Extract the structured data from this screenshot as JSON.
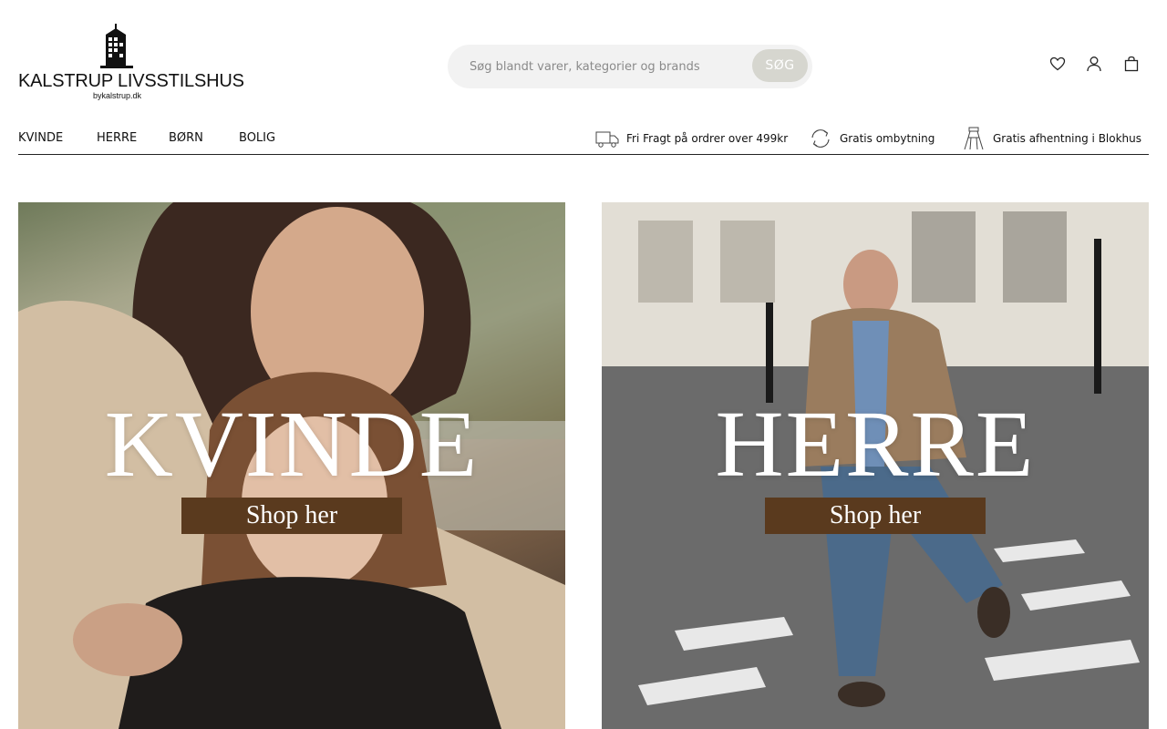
{
  "brand": {
    "name": "KALSTRUP LIVSSTILSHUS",
    "tagline": "bykalstrup.dk"
  },
  "search": {
    "placeholder": "Søg blandt varer, kategorier og brands",
    "button_label": "SØG"
  },
  "header_icons": [
    "heart-icon",
    "user-icon",
    "bag-icon"
  ],
  "nav": {
    "items": [
      {
        "label": "KVINDE"
      },
      {
        "label": "HERRE"
      },
      {
        "label": "BØRN"
      },
      {
        "label": "BOLIG"
      }
    ]
  },
  "usps": [
    {
      "icon": "truck-icon",
      "text": "Fri Fragt på ordrer over 499kr"
    },
    {
      "icon": "exchange-icon",
      "text": "Gratis ombytning"
    },
    {
      "icon": "pickup-icon",
      "text": "Gratis afhentning i Blokhus"
    }
  ],
  "tiles": [
    {
      "title": "KVINDE",
      "cta": "Shop her"
    },
    {
      "title": "HERRE",
      "cta": "Shop her"
    }
  ],
  "colors": {
    "cta_background": "#5a3a1e",
    "search_background": "#f2f2f2",
    "search_button": "#d6d6cf"
  }
}
